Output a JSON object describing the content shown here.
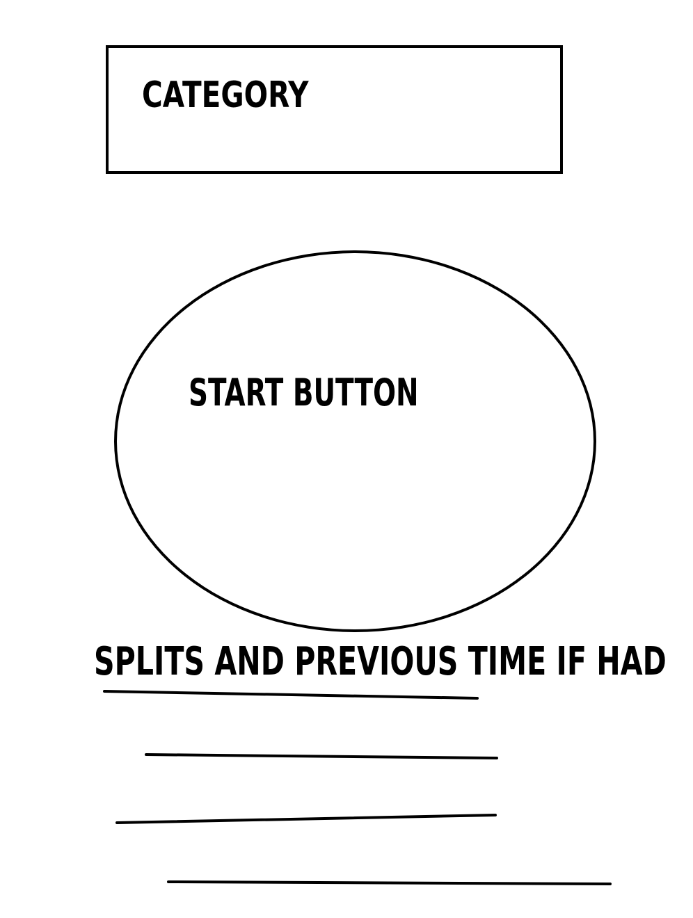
{
  "category": {
    "label": "CATEGORY"
  },
  "start_button": {
    "label": "START BUTTON"
  },
  "splits": {
    "heading": "SPLITS AND PREVIOUS TIME IF HAD",
    "line_count": 4
  },
  "colors": {
    "ink": "#000000",
    "background": "#ffffff"
  }
}
